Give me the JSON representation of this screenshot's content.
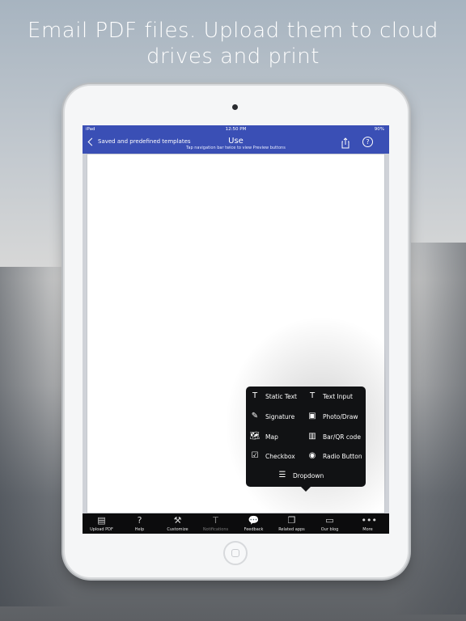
{
  "headline": {
    "line1": "Email PDF files. Upload them to cloud",
    "line2": "drives and print"
  },
  "status_bar": {
    "carrier": "iPad",
    "time": "12:50 PM",
    "battery": "90%"
  },
  "navbar": {
    "back_label": "Saved and predefined templates",
    "title": "Use",
    "subtitle": "Tap navigation bar twice to view Preview buttons",
    "help_symbol": "?",
    "share_icon": "share-icon",
    "color": "#3a4fb5"
  },
  "field_menu": {
    "items": [
      {
        "label": "Static Text",
        "icon": "T"
      },
      {
        "label": "Text Input",
        "icon": "T"
      },
      {
        "label": "Signature",
        "icon": "✎"
      },
      {
        "label": "Photo/Draw",
        "icon": "▣"
      },
      {
        "label": "Map",
        "icon": "🗺"
      },
      {
        "label": "Bar/QR code",
        "icon": "▥"
      },
      {
        "label": "Checkbox",
        "icon": "☑"
      },
      {
        "label": "Radio Button",
        "icon": "◉"
      },
      {
        "label": "Dropdown",
        "icon": "☰"
      }
    ]
  },
  "toolbar": {
    "items": [
      {
        "label": "Upload PDF",
        "icon": "upload-pdf-icon",
        "glyph": "▤"
      },
      {
        "label": "Help",
        "icon": "help-icon",
        "glyph": "?"
      },
      {
        "label": "Customize",
        "icon": "tools-icon",
        "glyph": "⚒"
      },
      {
        "label": "Notifications",
        "icon": "notifications-icon",
        "glyph": "T"
      },
      {
        "label": "Feedback",
        "icon": "feedback-icon",
        "glyph": "💬"
      },
      {
        "label": "Related apps",
        "icon": "related-apps-icon",
        "glyph": "❐"
      },
      {
        "label": "Our blog",
        "icon": "blog-icon",
        "glyph": "▭"
      },
      {
        "label": "More",
        "icon": "more-icon",
        "glyph": "•••"
      }
    ]
  }
}
